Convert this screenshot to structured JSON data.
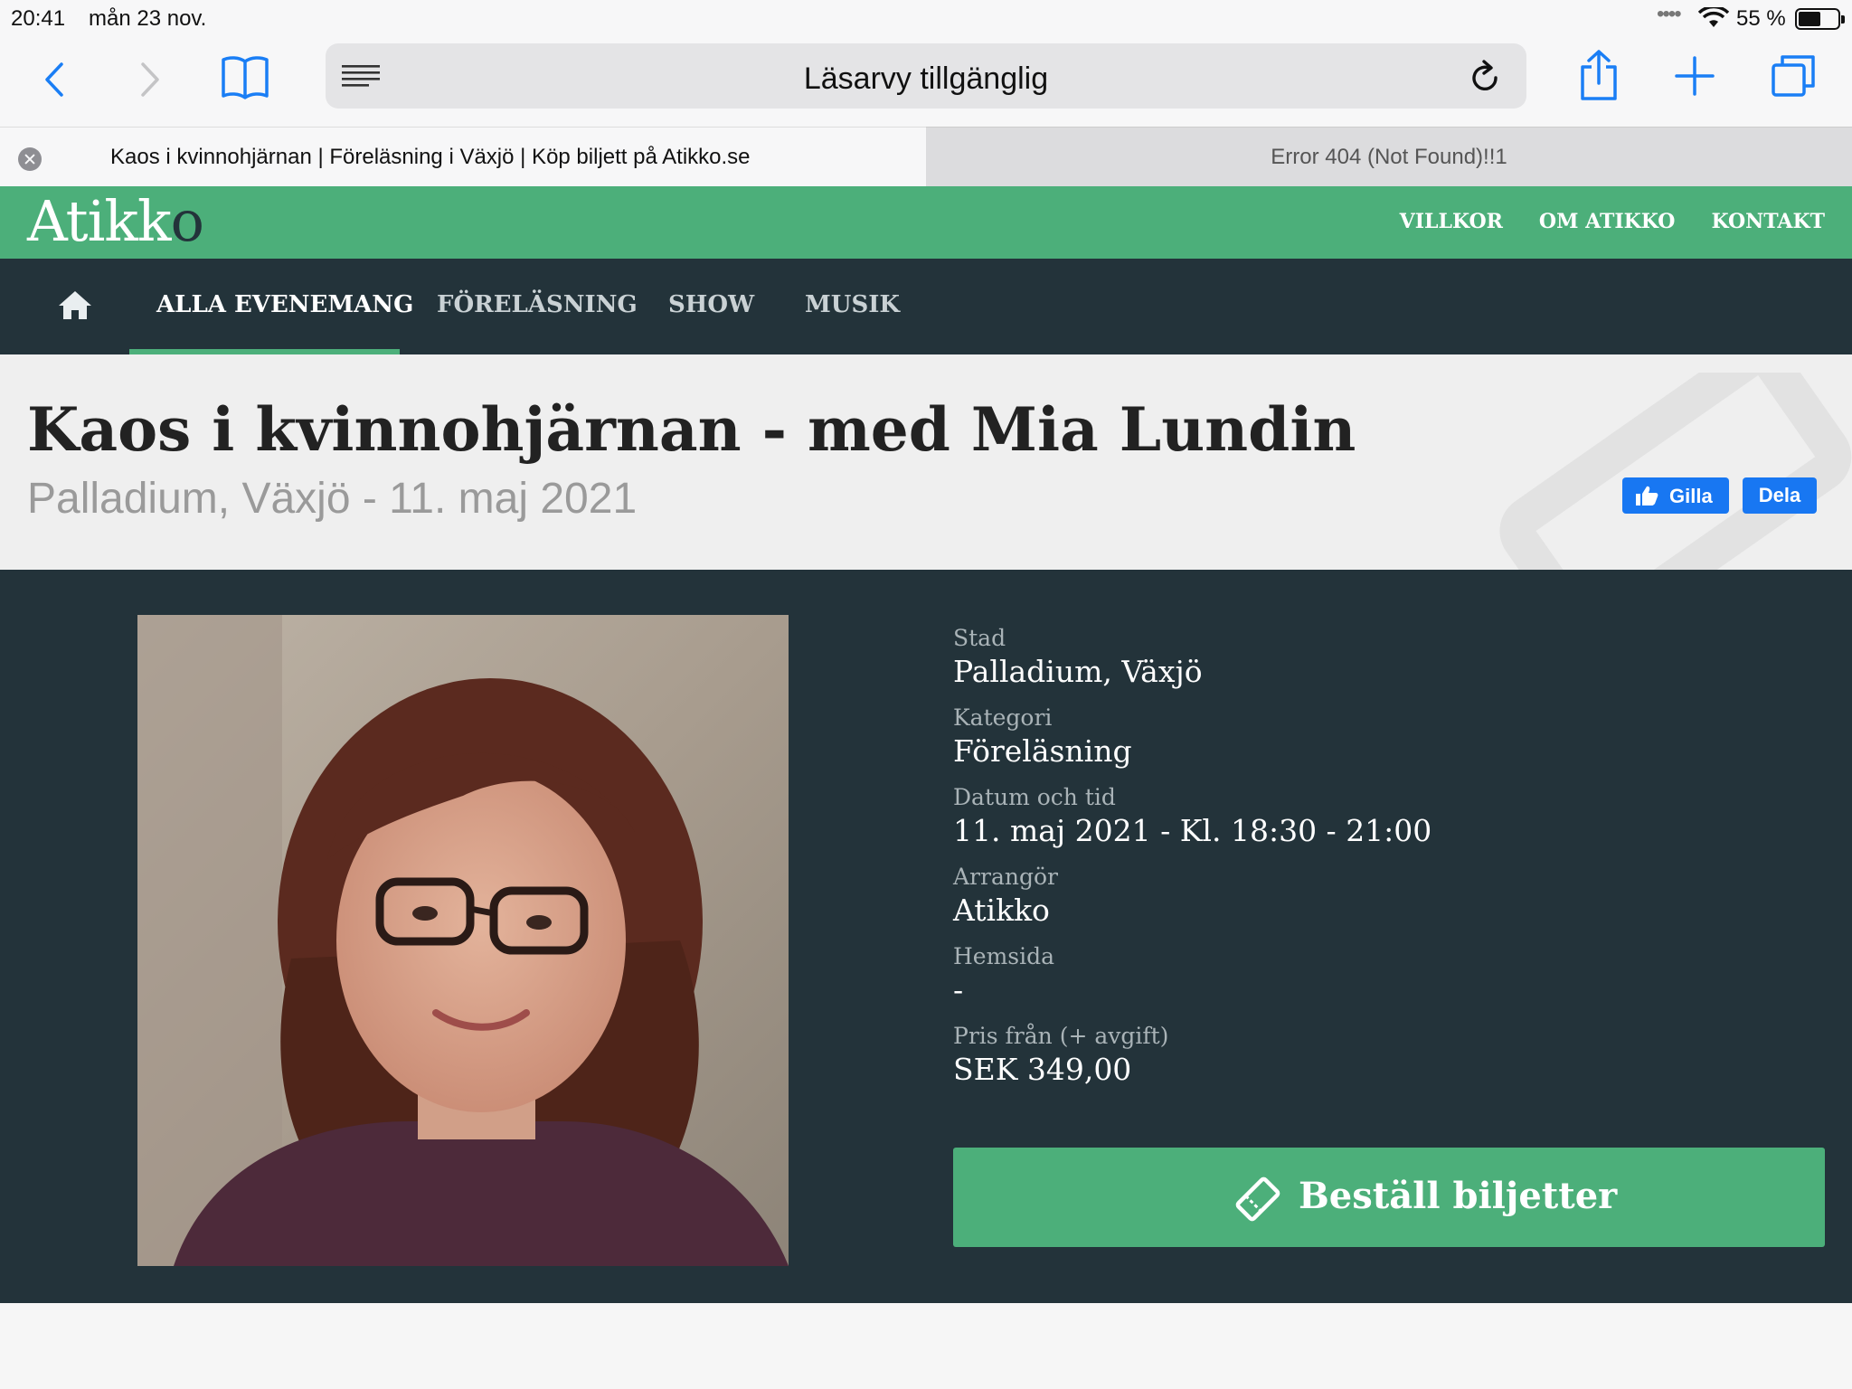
{
  "status": {
    "time": "20:41",
    "date": "mån 23 nov.",
    "battery_pct": "55 %"
  },
  "browser": {
    "reader_text": "Läsarvy tillgänglig",
    "tabs": [
      {
        "title": "Kaos i kvinnohjärnan | Föreläsning i Växjö | Köp biljett på Atikko.se"
      },
      {
        "title": "Error 404 (Not Found)!!1"
      }
    ]
  },
  "site": {
    "logo": "Atikk",
    "logo_last": "o",
    "top_links": [
      "VILLKOR",
      "OM ATIKKO",
      "KONTAKT"
    ],
    "nav": [
      "ALLA EVENEMANG",
      "FÖRELÄSNING",
      "SHOW",
      "MUSIK"
    ]
  },
  "event": {
    "title": "Kaos i kvinnohjärnan - med Mia Lundin",
    "subtitle": "Palladium, Växjö - 11. maj 2021",
    "like_label": "Gilla",
    "share_label": "Dela",
    "details": [
      {
        "label": "Stad",
        "value": "Palladium, Växjö"
      },
      {
        "label": "Kategori",
        "value": "Föreläsning"
      },
      {
        "label": "Datum och tid",
        "value": "11. maj 2021 - Kl. 18:30 - 21:00"
      },
      {
        "label": "Arrangör",
        "value": "Atikko"
      },
      {
        "label": "Hemsida",
        "value": "-"
      },
      {
        "label": "Pris från (+ avgift)",
        "value": "SEK 349,00"
      }
    ],
    "order_label": "Beställ biljetter"
  },
  "colors": {
    "brand_green": "#4caf7a",
    "dark": "#23333a",
    "ios_blue": "#1a7ef5",
    "fb_blue": "#1877f2"
  }
}
